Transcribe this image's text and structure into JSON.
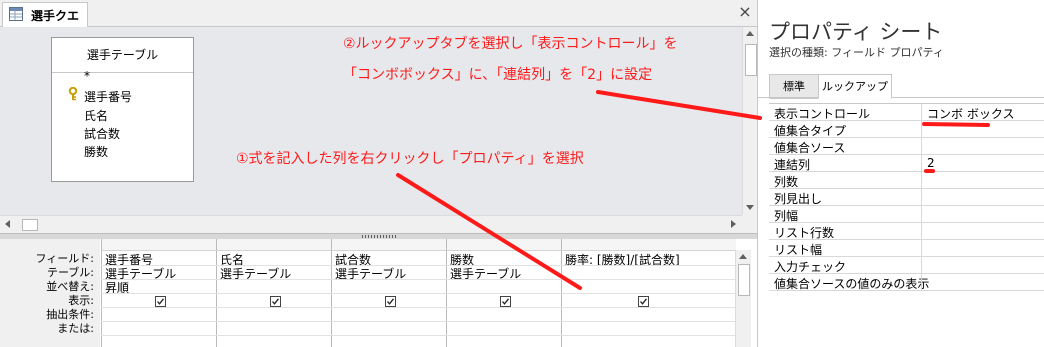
{
  "query_tab": {
    "label": "選手クエリ"
  },
  "close_label": "×",
  "table_box": {
    "title": "選手テーブル",
    "fields": [
      "*",
      "選手番号",
      "氏名",
      "試合数",
      "勝数"
    ]
  },
  "grid": {
    "row_labels": [
      "フィールド:",
      "テーブル:",
      "並べ替え:",
      "表示:",
      "抽出条件:",
      "または:"
    ],
    "columns": [
      {
        "field": "選手番号",
        "table": "選手テーブル",
        "sort": "昇順",
        "show": true
      },
      {
        "field": "氏名",
        "table": "選手テーブル",
        "sort": "",
        "show": true
      },
      {
        "field": "試合数",
        "table": "選手テーブル",
        "sort": "",
        "show": true
      },
      {
        "field": "勝数",
        "table": "選手テーブル",
        "sort": "",
        "show": true
      },
      {
        "field": "勝率: [勝数]/[試合数]",
        "table": "",
        "sort": "",
        "show": true
      }
    ]
  },
  "property_sheet": {
    "title": "プロパティ シート",
    "selection_type": "選択の種類: フィールド プロパティ",
    "tabs": [
      "標準",
      "ルックアップ"
    ],
    "active_tab": "ルックアップ",
    "properties": [
      {
        "name": "表示コントロール",
        "value": "コンボ ボックス"
      },
      {
        "name": "値集合タイプ",
        "value": ""
      },
      {
        "name": "値集合ソース",
        "value": ""
      },
      {
        "name": "連結列",
        "value": "2"
      },
      {
        "name": "列数",
        "value": ""
      },
      {
        "name": "列見出し",
        "value": ""
      },
      {
        "name": "列幅",
        "value": ""
      },
      {
        "name": "リスト行数",
        "value": ""
      },
      {
        "name": "リスト幅",
        "value": ""
      },
      {
        "name": "入力チェック",
        "value": ""
      },
      {
        "name": "値集合ソースの値のみの表示",
        "value": ""
      }
    ]
  },
  "annotations": {
    "step1": "①式を記入した列を右クリックし「プロパティ」を選択",
    "step2_line1": "②ルックアップタブを選択し「表示コントロール」を",
    "step2_line2": "「コンボボックス」に、「連結列」を「2」に設定"
  },
  "colors": {
    "annotation": "#ff1a1a",
    "key_icon": "#c8a000"
  }
}
